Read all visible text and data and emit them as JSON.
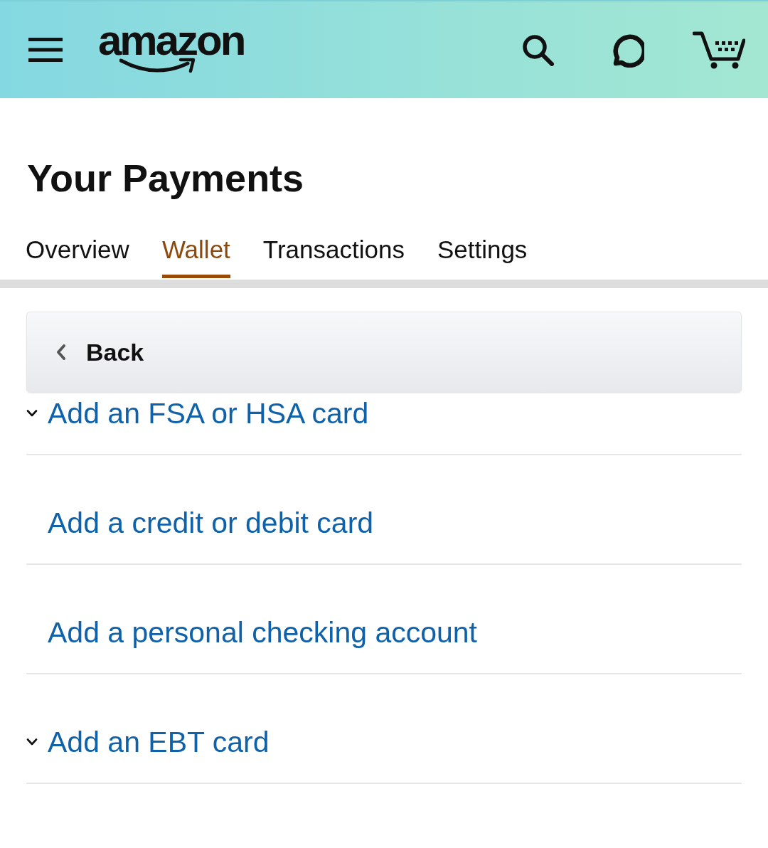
{
  "header": {
    "logo": "amazon"
  },
  "page": {
    "title": "Your Payments"
  },
  "tabs": [
    {
      "label": "Overview",
      "selected": false
    },
    {
      "label": "Wallet",
      "selected": true
    },
    {
      "label": "Transactions",
      "selected": false
    },
    {
      "label": "Settings",
      "selected": false
    }
  ],
  "back_button": {
    "label": "Back"
  },
  "options": [
    {
      "kind": "accordion",
      "label": "Add an FSA or HSA card",
      "expanded": false
    },
    {
      "kind": "link",
      "label": "Add a credit or debit card"
    },
    {
      "kind": "link",
      "label": "Add a personal checking account"
    },
    {
      "kind": "accordion",
      "label": "Add an EBT card",
      "expanded": false
    }
  ]
}
